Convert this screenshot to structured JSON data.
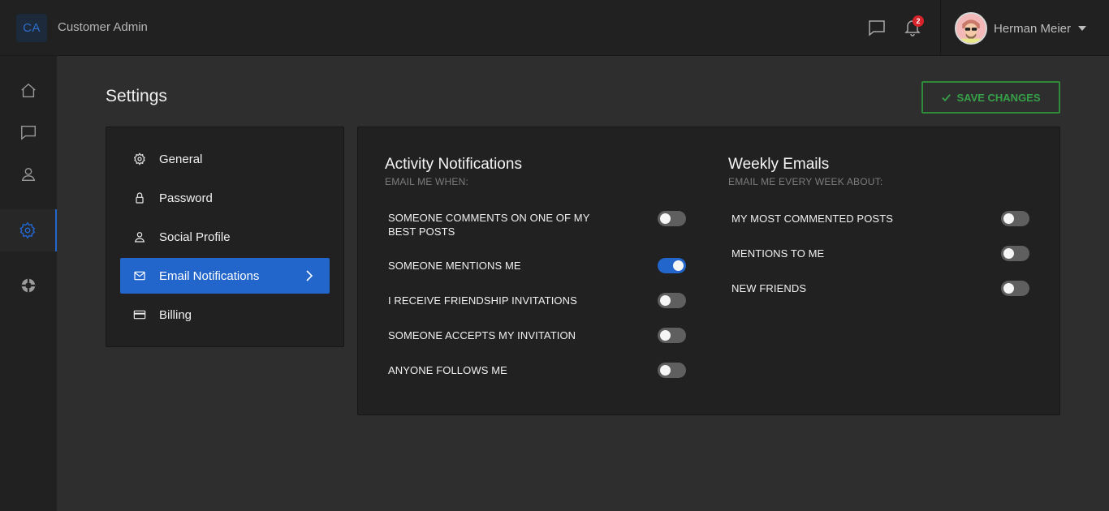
{
  "header": {
    "logo_text": "CA",
    "app_name": "Customer Admin",
    "notification_count": "2",
    "user_name": "Herman Meier"
  },
  "rail": {
    "items": [
      "home-icon",
      "chat-icon",
      "user-icon",
      "settings-icon",
      "help-icon"
    ],
    "active": "settings-icon"
  },
  "page": {
    "title": "Settings",
    "save_label": "SAVE CHANGES"
  },
  "settings_menu": {
    "items": [
      {
        "label": "General",
        "icon": "gear-icon"
      },
      {
        "label": "Password",
        "icon": "lock-icon"
      },
      {
        "label": "Social Profile",
        "icon": "user-icon"
      },
      {
        "label": "Email Notifications",
        "icon": "envelope-icon",
        "active": true
      },
      {
        "label": "Billing",
        "icon": "credit-card-icon"
      }
    ]
  },
  "activity": {
    "title": "Activity Notifications",
    "subtitle": "EMAIL ME WHEN:",
    "options": [
      {
        "label": "SOMEONE COMMENTS ON ONE OF MY BEST POSTS",
        "enabled": false
      },
      {
        "label": "SOMEONE MENTIONS ME",
        "enabled": true
      },
      {
        "label": "I RECEIVE FRIENDSHIP INVITATIONS",
        "enabled": false
      },
      {
        "label": "SOMEONE ACCEPTS MY INVITATION",
        "enabled": false
      },
      {
        "label": "ANYONE FOLLOWS ME",
        "enabled": false
      }
    ]
  },
  "weekly": {
    "title": "Weekly Emails",
    "subtitle": "EMAIL ME EVERY WEEK ABOUT:",
    "options": [
      {
        "label": "MY MOST COMMENTED POSTS",
        "enabled": false
      },
      {
        "label": "MENTIONS TO ME",
        "enabled": false
      },
      {
        "label": "NEW FRIENDS",
        "enabled": false
      }
    ]
  },
  "colors": {
    "accent": "#2266cc",
    "save_green": "#36a048",
    "badge_red": "#d8232a"
  }
}
